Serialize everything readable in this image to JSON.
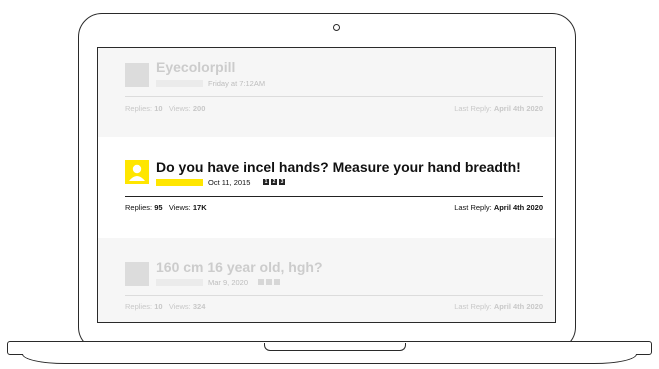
{
  "threads": [
    {
      "title": "Eyecolorpill",
      "date": "Friday at 7:12AM",
      "replies_label": "Replies:",
      "replies": "10",
      "views_label": "Views:",
      "views": "200",
      "last_reply_label": "Last Reply:",
      "last_reply": "April 4th 2020"
    },
    {
      "title": "Do you have incel hands? Measure your hand breadth!",
      "date": "Oct 11, 2015",
      "pages": [
        "1",
        "2",
        "3"
      ],
      "replies_label": "Replies:",
      "replies": "95",
      "views_label": "Views:",
      "views": "17K",
      "last_reply_label": "Last Reply:",
      "last_reply": "April 4th 2020"
    },
    {
      "title": "160 cm 16 year old, hgh?",
      "date": "Mar 9, 2020",
      "replies_label": "Replies:",
      "replies": "10",
      "views_label": "Views:",
      "views": "324",
      "last_reply_label": "Last Reply:",
      "last_reply": "April 4th 2020"
    }
  ],
  "colors": {
    "accent": "#ffe600",
    "faded_bg": "#f6f6f6",
    "outline": "#2a2a2a"
  }
}
